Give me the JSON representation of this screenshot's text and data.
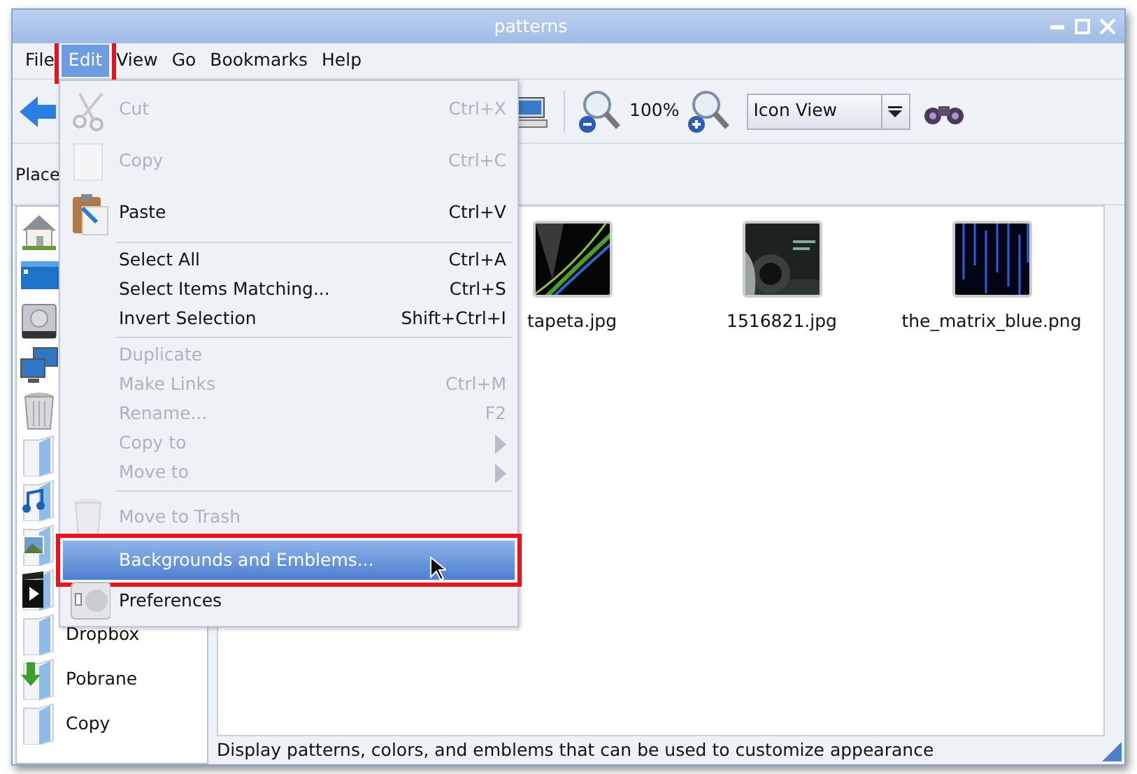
{
  "window": {
    "title": "patterns"
  },
  "menubar": [
    {
      "label": "File",
      "selected": false
    },
    {
      "label": "Edit",
      "selected": true
    },
    {
      "label": "View",
      "selected": false
    },
    {
      "label": "Go",
      "selected": false
    },
    {
      "label": "Bookmarks",
      "selected": false
    },
    {
      "label": "Help",
      "selected": false
    }
  ],
  "toolbar": {
    "zoom": "100%",
    "view_select": "Icon View"
  },
  "location": {
    "label": "Place"
  },
  "sidebar": {
    "items": [
      {
        "label": "Dropbox"
      },
      {
        "label": "Pobrane"
      },
      {
        "label": "Copy"
      }
    ]
  },
  "files": [
    {
      "name": "tapeta.jpg"
    },
    {
      "name": "1516821.jpg"
    },
    {
      "name": "the_matrix_blue.png"
    }
  ],
  "edit_menu": [
    {
      "kind": "item",
      "label": "Cut",
      "shortcut": "Ctrl+X",
      "disabled": true,
      "selected": false
    },
    {
      "kind": "item",
      "label": "Copy",
      "shortcut": "Ctrl+C",
      "disabled": true,
      "selected": false
    },
    {
      "kind": "item",
      "label": "Paste",
      "shortcut": "Ctrl+V",
      "disabled": false,
      "selected": false
    },
    {
      "kind": "separator"
    },
    {
      "kind": "item",
      "label": "Select All",
      "shortcut": "Ctrl+A",
      "disabled": false,
      "selected": false
    },
    {
      "kind": "item",
      "label": "Select Items Matching...",
      "shortcut": "Ctrl+S",
      "disabled": false,
      "selected": false
    },
    {
      "kind": "item",
      "label": "Invert Selection",
      "shortcut": "Shift+Ctrl+I",
      "disabled": false,
      "selected": false
    },
    {
      "kind": "separator"
    },
    {
      "kind": "item",
      "label": "Duplicate",
      "disabled": true,
      "selected": false
    },
    {
      "kind": "item",
      "label": "Make Links",
      "shortcut": "Ctrl+M",
      "disabled": true,
      "selected": false
    },
    {
      "kind": "item",
      "label": "Rename...",
      "shortcut": "F2",
      "disabled": true,
      "selected": false
    },
    {
      "kind": "submenu",
      "label": "Copy to",
      "disabled": true,
      "selected": false
    },
    {
      "kind": "submenu",
      "label": "Move to",
      "disabled": true,
      "selected": false
    },
    {
      "kind": "separator"
    },
    {
      "kind": "item",
      "label": "Move to Trash",
      "disabled": true,
      "selected": false
    },
    {
      "kind": "item",
      "label": "Backgrounds and Emblems...",
      "disabled": false,
      "selected": true
    },
    {
      "kind": "item",
      "label": "Preferences",
      "disabled": false,
      "selected": false
    }
  ],
  "status_bar": "Display patterns, colors, and emblems that can be used to customize appearance"
}
